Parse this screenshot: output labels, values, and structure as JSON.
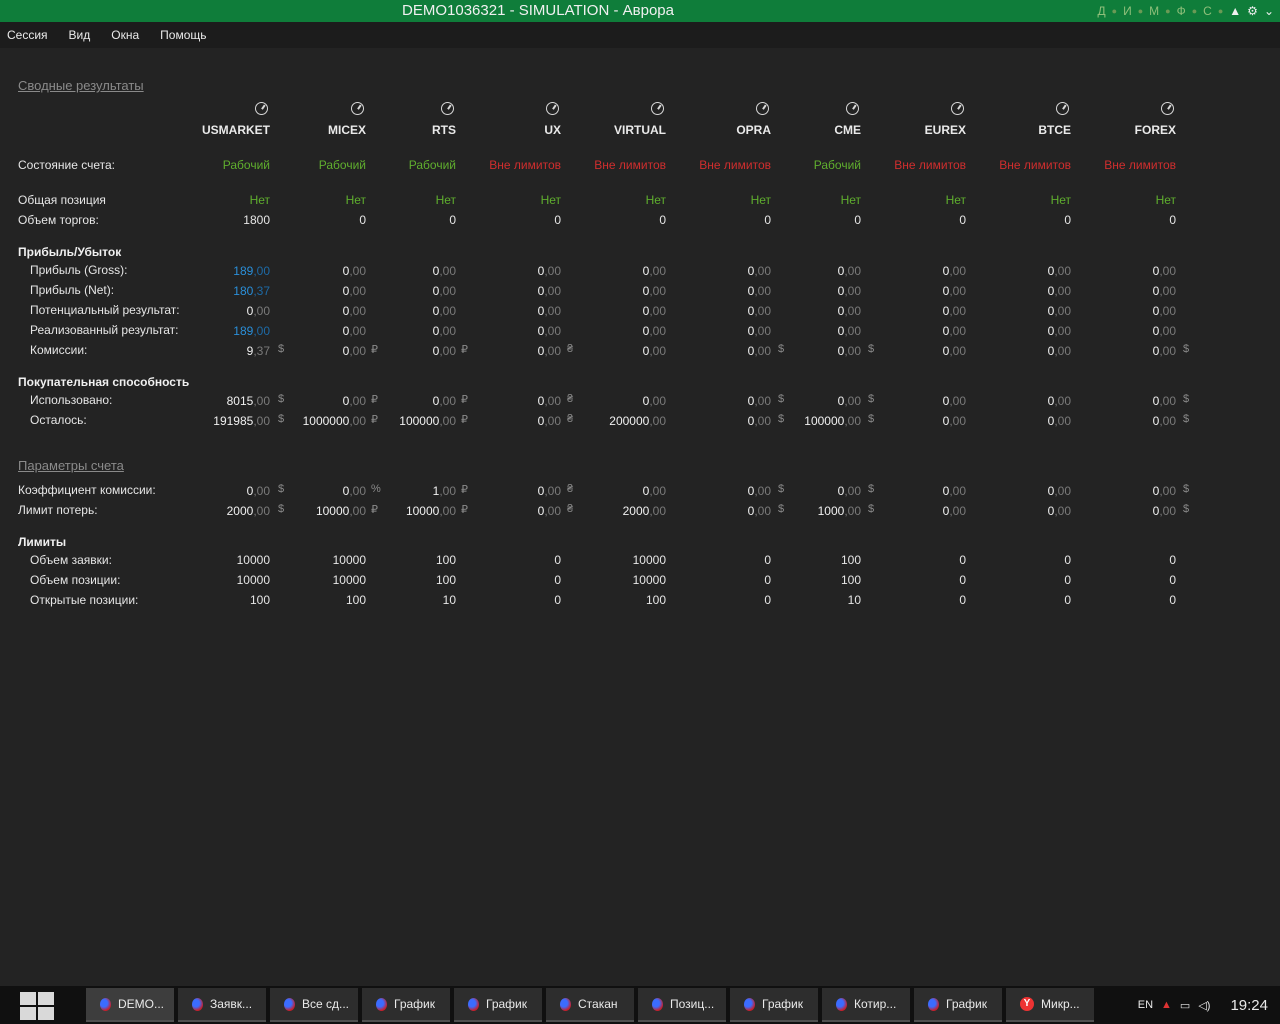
{
  "window": {
    "title": "DEMO1036321 - SIMULATION - Аврора"
  },
  "title_tabs": [
    "Д",
    "И",
    "М",
    "Ф",
    "С"
  ],
  "title_icons": [
    "triangle-up-icon",
    "gear-icon",
    "chevron-down-icon"
  ],
  "menu": [
    "Сессия",
    "Вид",
    "Окна",
    "Помощь"
  ],
  "sections": {
    "summary": "Сводные результаты",
    "params": "Параметры счета"
  },
  "markets": [
    "USMARKET",
    "MICEX",
    "RTS",
    "UX",
    "VIRTUAL",
    "OPRA",
    "CME",
    "EUREX",
    "BTCE",
    "FOREX"
  ],
  "labels": {
    "account_state": "Состояние счета:",
    "total_position": "Общая позиция",
    "trade_volume": "Объем торгов:",
    "pnl_group": "Прибыль/Убыток",
    "gross": "Прибыль (Gross):",
    "net": "Прибыль (Net):",
    "potential": "Потенциальный результат:",
    "realized": "Реализованный результат:",
    "commission": "Комиссии:",
    "buying_group": "Покупательная способность",
    "used": "Использовано:",
    "remaining": "Осталось:",
    "commission_rate": "Коэффициент комиссии:",
    "loss_limit": "Лимит потерь:",
    "limits_group": "Лимиты",
    "order_volume": "Объем заявки:",
    "position_volume": "Объем позиции:",
    "open_positions": "Открытые позиции:"
  },
  "colors": {
    "ok": "#5fae2e",
    "warn": "#cf2e2e",
    "profit": "#2a8fd9"
  },
  "account_state": [
    "Рабочий",
    "Рабочий",
    "Рабочий",
    "Вне лимитов",
    "Вне лимитов",
    "Вне лимитов",
    "Рабочий",
    "Вне лимитов",
    "Вне лимитов",
    "Вне лимитов"
  ],
  "total_position": [
    "Нет",
    "Нет",
    "Нет",
    "Нет",
    "Нет",
    "Нет",
    "Нет",
    "Нет",
    "Нет",
    "Нет"
  ],
  "trade_volume": [
    "1800",
    "0",
    "0",
    "0",
    "0",
    "0",
    "0",
    "0",
    "0",
    "0"
  ],
  "currencies": [
    "$",
    "₽",
    "₽",
    "₴",
    "",
    "$",
    "$",
    "",
    "",
    "$"
  ],
  "gross": [
    [
      "189",
      ",00"
    ],
    [
      "0",
      ",00"
    ],
    [
      "0",
      ",00"
    ],
    [
      "0",
      ",00"
    ],
    [
      "0",
      ",00"
    ],
    [
      "0",
      ",00"
    ],
    [
      "0",
      ",00"
    ],
    [
      "0",
      ",00"
    ],
    [
      "0",
      ",00"
    ],
    [
      "0",
      ",00"
    ]
  ],
  "net": [
    [
      "180",
      ",37"
    ],
    [
      "0",
      ",00"
    ],
    [
      "0",
      ",00"
    ],
    [
      "0",
      ",00"
    ],
    [
      "0",
      ",00"
    ],
    [
      "0",
      ",00"
    ],
    [
      "0",
      ",00"
    ],
    [
      "0",
      ",00"
    ],
    [
      "0",
      ",00"
    ],
    [
      "0",
      ",00"
    ]
  ],
  "potential": [
    [
      "0",
      ",00"
    ],
    [
      "0",
      ",00"
    ],
    [
      "0",
      ",00"
    ],
    [
      "0",
      ",00"
    ],
    [
      "0",
      ",00"
    ],
    [
      "0",
      ",00"
    ],
    [
      "0",
      ",00"
    ],
    [
      "0",
      ",00"
    ],
    [
      "0",
      ",00"
    ],
    [
      "0",
      ",00"
    ]
  ],
  "realized": [
    [
      "189",
      ",00"
    ],
    [
      "0",
      ",00"
    ],
    [
      "0",
      ",00"
    ],
    [
      "0",
      ",00"
    ],
    [
      "0",
      ",00"
    ],
    [
      "0",
      ",00"
    ],
    [
      "0",
      ",00"
    ],
    [
      "0",
      ",00"
    ],
    [
      "0",
      ",00"
    ],
    [
      "0",
      ",00"
    ]
  ],
  "commission": [
    [
      "9",
      ",37"
    ],
    [
      "0",
      ",00"
    ],
    [
      "0",
      ",00"
    ],
    [
      "0",
      ",00"
    ],
    [
      "0",
      ",00"
    ],
    [
      "0",
      ",00"
    ],
    [
      "0",
      ",00"
    ],
    [
      "0",
      ",00"
    ],
    [
      "0",
      ",00"
    ],
    [
      "0",
      ",00"
    ]
  ],
  "used": [
    [
      "8015",
      ",00"
    ],
    [
      "0",
      ",00"
    ],
    [
      "0",
      ",00"
    ],
    [
      "0",
      ",00"
    ],
    [
      "0",
      ",00"
    ],
    [
      "0",
      ",00"
    ],
    [
      "0",
      ",00"
    ],
    [
      "0",
      ",00"
    ],
    [
      "0",
      ",00"
    ],
    [
      "0",
      ",00"
    ]
  ],
  "remaining": [
    [
      "191985",
      ",00"
    ],
    [
      "1000000",
      ",00"
    ],
    [
      "100000",
      ",00"
    ],
    [
      "0",
      ",00"
    ],
    [
      "200000",
      ",00"
    ],
    [
      "0",
      ",00"
    ],
    [
      "100000",
      ",00"
    ],
    [
      "0",
      ",00"
    ],
    [
      "0",
      ",00"
    ],
    [
      "0",
      ",00"
    ]
  ],
  "commission_rate": [
    [
      "0",
      ",00"
    ],
    [
      "0",
      ",00"
    ],
    [
      "1",
      ",00"
    ],
    [
      "0",
      ",00"
    ],
    [
      "0",
      ",00"
    ],
    [
      "0",
      ",00"
    ],
    [
      "0",
      ",00"
    ],
    [
      "0",
      ",00"
    ],
    [
      "0",
      ",00"
    ],
    [
      "0",
      ",00"
    ]
  ],
  "commission_rate_cur": [
    "$",
    "%",
    "₽",
    "₴",
    "",
    "$",
    "$",
    "",
    "",
    "$"
  ],
  "loss_limit": [
    [
      "2000",
      ",00"
    ],
    [
      "10000",
      ",00"
    ],
    [
      "10000",
      ",00"
    ],
    [
      "0",
      ",00"
    ],
    [
      "2000",
      ",00"
    ],
    [
      "0",
      ",00"
    ],
    [
      "1000",
      ",00"
    ],
    [
      "0",
      ",00"
    ],
    [
      "0",
      ",00"
    ],
    [
      "0",
      ",00"
    ]
  ],
  "order_volume": [
    "10000",
    "10000",
    "100",
    "0",
    "10000",
    "0",
    "100",
    "0",
    "0",
    "0"
  ],
  "position_volume": [
    "10000",
    "10000",
    "100",
    "0",
    "10000",
    "0",
    "100",
    "0",
    "0",
    "0"
  ],
  "open_positions": [
    "100",
    "100",
    "10",
    "0",
    "100",
    "0",
    "10",
    "0",
    "0",
    "0"
  ],
  "taskbar": {
    "items": [
      "DEMO...",
      "Заявк...",
      "Все сд...",
      "График",
      "График",
      "Стакан",
      "Позиц...",
      "График",
      "Котир...",
      "График",
      "Микр..."
    ],
    "lang": "EN",
    "time": "19:24"
  }
}
